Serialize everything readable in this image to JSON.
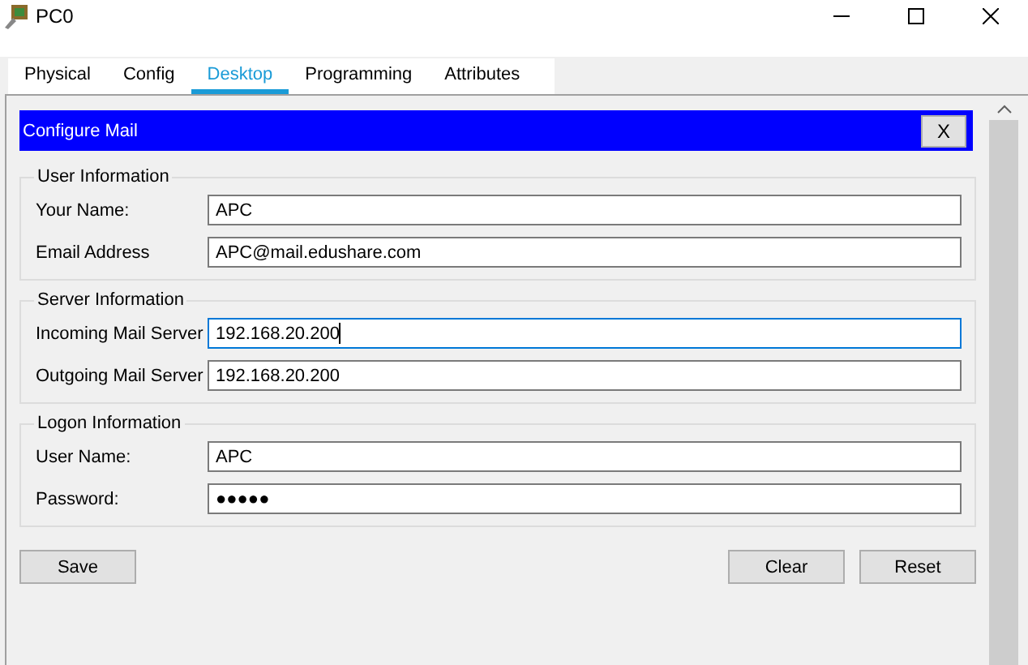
{
  "window": {
    "title": "PC0"
  },
  "tabs": [
    {
      "label": "Physical",
      "selected": false
    },
    {
      "label": "Config",
      "selected": false
    },
    {
      "label": "Desktop",
      "selected": true
    },
    {
      "label": "Programming",
      "selected": false
    },
    {
      "label": "Attributes",
      "selected": false
    }
  ],
  "dialog": {
    "title": "Configure Mail",
    "close": "X"
  },
  "groups": [
    {
      "title": "User Information",
      "fields": [
        {
          "label": "Your Name:",
          "value": "APC",
          "focused": false
        },
        {
          "label": "Email Address",
          "value": "APC@mail.edushare.com",
          "focused": false
        }
      ]
    },
    {
      "title": "Server Information",
      "fields": [
        {
          "label": "Incoming Mail Server",
          "value": "192.168.20.200",
          "focused": true
        },
        {
          "label": "Outgoing Mail Server",
          "value": "192.168.20.200",
          "focused": false
        }
      ]
    },
    {
      "title": "Logon Information",
      "fields": [
        {
          "label": "User Name:",
          "value": "APC",
          "focused": false
        },
        {
          "label": "Password:",
          "value": "●●●●●",
          "focused": false
        }
      ]
    }
  ],
  "buttons_left": [
    "Save"
  ],
  "buttons_right": [
    "Clear",
    "Reset"
  ]
}
